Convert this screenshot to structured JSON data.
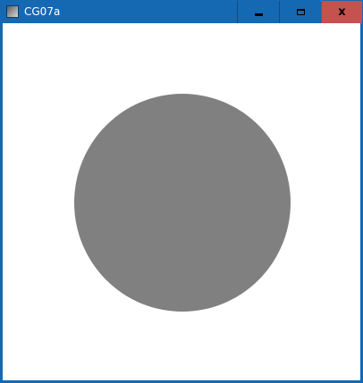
{
  "window": {
    "title": "CG07a",
    "titlebar_color": "#1569b3",
    "close_button_color": "#c75050"
  },
  "controls": {
    "minimize_icon": "minimize-icon",
    "maximize_icon": "maximize-icon",
    "close_icon": "close-icon",
    "close_glyph": "x"
  },
  "canvas": {
    "background": "#ffffff",
    "shape": "circle",
    "shape_color": "#808080"
  }
}
